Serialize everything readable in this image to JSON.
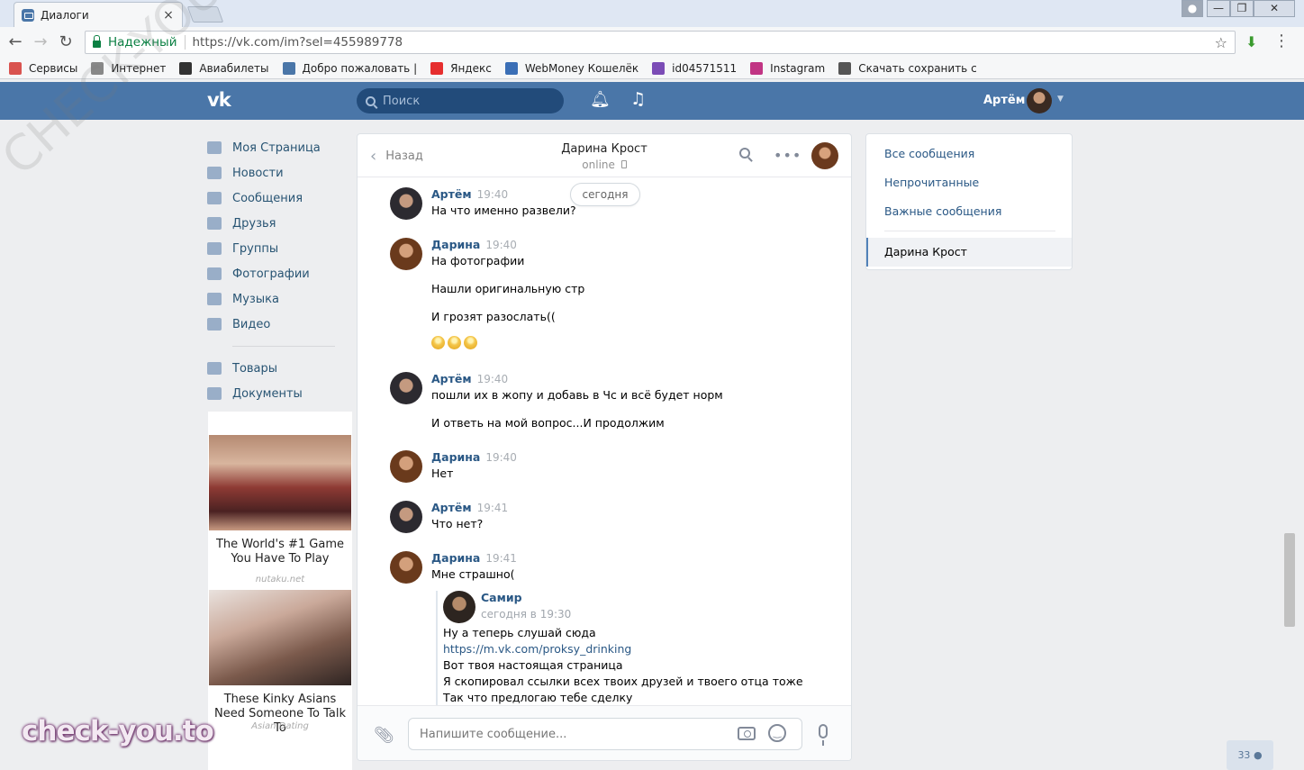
{
  "browser": {
    "tab_title": "Диалоги",
    "tab_close": "×",
    "secure_label": "Надежный",
    "url": "https://vk.com/im?sel=455989778",
    "window_min": "—",
    "window_max": "❐",
    "window_close": "✕",
    "bookmarks": [
      {
        "label": "Сервисы",
        "icon": "apps-grid-icon",
        "color": "#d9534f"
      },
      {
        "label": "Интернет",
        "icon": "page-icon",
        "color": "#888888"
      },
      {
        "label": "Авиабилеты",
        "icon": "plane-icon",
        "color": "#333333"
      },
      {
        "label": "Добро пожаловать |",
        "icon": "vk-icon",
        "color": "#4a76a8"
      },
      {
        "label": "Яндекс",
        "icon": "yandex-icon",
        "color": "#e62e2e"
      },
      {
        "label": "WebMoney Кошелёк",
        "icon": "webmoney-icon",
        "color": "#3b6fb6"
      },
      {
        "label": "id04571511",
        "icon": "s-icon",
        "color": "#7b4cb6"
      },
      {
        "label": "Instagram",
        "icon": "instagram-icon",
        "color": "#c13584"
      },
      {
        "label": "Скачать сохранить с",
        "icon": "download-site-icon",
        "color": "#555555"
      }
    ]
  },
  "header": {
    "logo": "vk",
    "search_placeholder": "Поиск",
    "user_name": "Артём"
  },
  "left_menu": {
    "items": [
      {
        "label": "Моя Страница",
        "icon": "home-icon"
      },
      {
        "label": "Новости",
        "icon": "news-icon"
      },
      {
        "label": "Сообщения",
        "icon": "messages-icon"
      },
      {
        "label": "Друзья",
        "icon": "friends-icon"
      },
      {
        "label": "Группы",
        "icon": "groups-icon"
      },
      {
        "label": "Фотографии",
        "icon": "camera-icon"
      },
      {
        "label": "Музыка",
        "icon": "music-icon"
      },
      {
        "label": "Видео",
        "icon": "video-icon"
      }
    ],
    "items2": [
      {
        "label": "Товары",
        "icon": "bag-icon"
      },
      {
        "label": "Документы",
        "icon": "document-icon"
      }
    ]
  },
  "ads": [
    {
      "title": "The World's #1 Game You Have To Play",
      "source": "nutaku.net"
    },
    {
      "title": "These Kinky Asians Need Someone To Talk To",
      "source": "Asian Dating"
    }
  ],
  "chat": {
    "back_label": "Назад",
    "peer_name": "Дарина Крост",
    "peer_status": "online",
    "today_label": "сегодня",
    "messages": [
      {
        "author": "Артём",
        "time": "19:40",
        "lines": [
          "На что именно развели?"
        ]
      },
      {
        "author": "Дарина",
        "time": "19:40",
        "lines": [
          "На фотографии",
          "Нашли оригинальную стр",
          "И грозят разослать(("
        ]
      },
      {
        "author": "Артём",
        "time": "19:40",
        "lines": [
          "пошли их в жопу и добавь в Чс и всё будет норм",
          "И ответь на мой вопрос...И продолжим"
        ]
      },
      {
        "author": "Дарина",
        "time": "19:40",
        "lines": [
          "Нет"
        ]
      },
      {
        "author": "Артём",
        "time": "19:41",
        "lines": [
          "Что нет?"
        ]
      },
      {
        "author": "Дарина",
        "time": "19:41",
        "lines": [
          "Мне страшно("
        ]
      }
    ],
    "forwarded": {
      "author": "Самир",
      "time": "сегодня в 19:30",
      "lines": [
        "Ну а теперь слушай сюда",
        "https://m.vk.com/proksy_drinking",
        "Вот твоя настоящая страница",
        "Я скопировал ссылки всех твоих друзей и твоего отца тоже",
        "Так что предлогаю тебе сделку"
      ]
    },
    "input_placeholder": "Напишите сообщение..."
  },
  "right_panel": {
    "items": [
      "Все сообщения",
      "Непрочитанные",
      "Важные сообщения"
    ],
    "active": "Дарина Крост"
  },
  "counter": "33",
  "watermark": "check-you.to",
  "watermark_diag": "CHECK-YOU.ME"
}
